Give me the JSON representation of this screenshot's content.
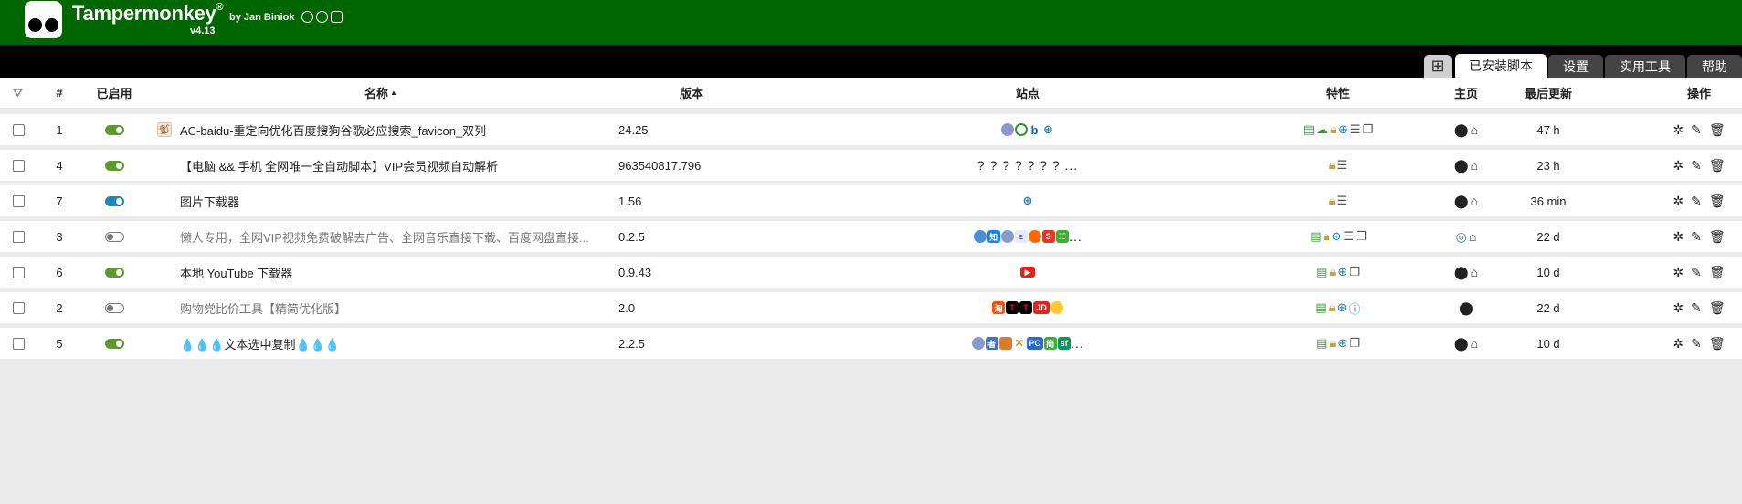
{
  "app": {
    "title": "Tampermonkey",
    "registered": "®",
    "byline": "by Jan Biniok",
    "version": "v4.13"
  },
  "tabs": [
    {
      "label": "已安装脚本",
      "active": true
    },
    {
      "label": "设置",
      "active": false
    },
    {
      "label": "实用工具",
      "active": false
    },
    {
      "label": "帮助",
      "active": false
    }
  ],
  "columns": {
    "number": "#",
    "enabled": "已启用",
    "name": "名称",
    "version": "版本",
    "sites": "站点",
    "features": "特性",
    "homepage": "主页",
    "updated": "最后更新",
    "actions": "操作"
  },
  "scripts": [
    {
      "num": "1",
      "enabled": true,
      "toggle_color": "green",
      "name": "AC-baidu-重定向优化百度搜狗谷歌必应搜索_favicon_双列",
      "dim": false,
      "version": "24.25",
      "sites_text": "",
      "updated": "47 h"
    },
    {
      "num": "4",
      "enabled": true,
      "toggle_color": "green",
      "name": "【电脑 && 手机 全网唯一全自动脚本】VIP会员视频自动解析",
      "dim": false,
      "version": "963540817.796",
      "sites_text": "? ? ? ? ? ? ? ...",
      "updated": "23 h"
    },
    {
      "num": "7",
      "enabled": true,
      "toggle_color": "blue",
      "name": "图片下载器",
      "dim": false,
      "version": "1.56",
      "sites_text": "",
      "updated": "36 min"
    },
    {
      "num": "3",
      "enabled": false,
      "toggle_color": "off",
      "name": "懒人专用，全网VIP视频免费破解去广告、全网音乐直接下载、百度网盘直接...",
      "dim": true,
      "version": "0.2.5",
      "sites_text": "...",
      "updated": "22 d"
    },
    {
      "num": "6",
      "enabled": true,
      "toggle_color": "green",
      "name": "本地 YouTube 下载器",
      "dim": false,
      "version": "0.9.43",
      "sites_text": "",
      "updated": "10 d"
    },
    {
      "num": "2",
      "enabled": false,
      "toggle_color": "off",
      "name": "购物党比价工具【精简优化版】",
      "dim": true,
      "version": "2.0",
      "sites_text": "",
      "updated": "22 d"
    },
    {
      "num": "5",
      "enabled": true,
      "toggle_color": "green",
      "name": "💧💧💧文本选中复制💧💧💧",
      "dim": false,
      "version": "2.2.5",
      "sites_text": "...",
      "updated": "10 d"
    }
  ],
  "site_badges": {
    "zhihu": "知",
    "csdn": "S",
    "taobao": "淘",
    "tmall": "T",
    "jd": "JD",
    "pc": "PC",
    "sf": "sf",
    "jianshu": "简",
    "zhe": "者"
  },
  "colors": {
    "header_bg": "#006600",
    "tabbar_bg": "#000000",
    "page_bg": "#ebebeb",
    "toggle_green": "#5c9a2a",
    "toggle_blue": "#1e88b8"
  },
  "icons": {
    "filter": "filter-icon",
    "add_tab": "plus-square-icon",
    "homepage": "home-icon",
    "author": "author-icon",
    "update": "bug-icon",
    "edit": "edit-icon",
    "delete": "trash-icon"
  }
}
